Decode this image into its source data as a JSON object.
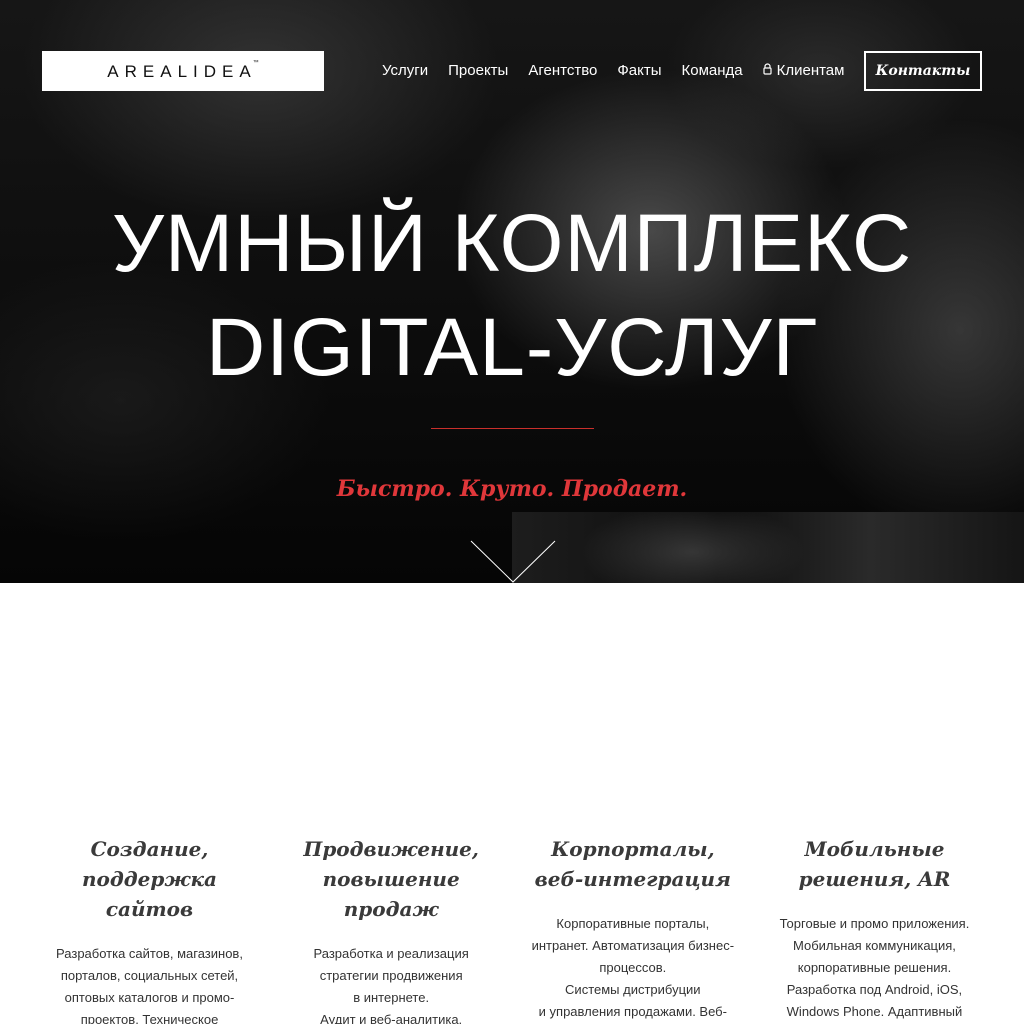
{
  "header": {
    "logo": "AREALIDEA",
    "logo_tm": "™",
    "nav": [
      {
        "label": "Услуги"
      },
      {
        "label": "Проекты"
      },
      {
        "label": "Агентство"
      },
      {
        "label": "Факты"
      },
      {
        "label": "Команда"
      },
      {
        "label": "Клиентам",
        "icon": "lock-icon"
      }
    ],
    "contact_button": "Контакты"
  },
  "hero": {
    "title_line1": "УМНЫЙ КОМПЛЕКС",
    "title_line2": "DIGITAL-УСЛУГ",
    "tagline": "Быстро. Круто. Продает.",
    "scroll_icon": "chevron-down-icon"
  },
  "services": [
    {
      "title": "Создание,\nподдержка сайтов",
      "desc": "Разработка сайтов, магазинов,\nпорталов, социальных сетей,\nоптовых каталогов и промо-\nпроектов. Техническое\nсопровождение, защита"
    },
    {
      "title": "Продвижение,\nповышение продаж",
      "desc": "Разработка и реализация\nстратегии продвижения\nв интернете.\nАудит и веб-аналитика.\nПоисковое продвижение. Запуск"
    },
    {
      "title": "Корпорталы,\nвеб-интеграция",
      "desc": "Корпоративные порталы,\nинтранет. Автоматизация бизнес-\nпроцессов.\nСистемы дистрибуции\nи управления продажами. Веб-"
    },
    {
      "title": "Мобильные\nрешения, AR",
      "desc": "Торговые и промо приложения.\nМобильная коммуникация,\nкорпоративные решения.\nРазработка под Android, iOS,\nWindows Phone. Адаптивный"
    }
  ],
  "colors": {
    "accent_red": "#e0373a",
    "hero_bg": "#0c0c0c"
  }
}
